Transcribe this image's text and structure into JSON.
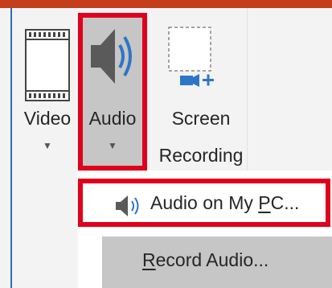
{
  "ribbon": {
    "video": {
      "label": "Video",
      "icon": "film-strip-icon"
    },
    "audio": {
      "label": "Audio",
      "icon": "speaker-icon",
      "highlight_color": "#e0001b"
    },
    "screen_recording": {
      "label_line1": "Screen",
      "label_line2": "Recording",
      "icon": "screen-recording-icon"
    }
  },
  "audio_menu": {
    "items": [
      {
        "label_prefix": "Audio on My ",
        "mnemonic": "P",
        "label_suffix": "C...",
        "icon": "speaker-icon",
        "highlighted": true
      },
      {
        "mnemonic": "R",
        "label_suffix": "ecord Audio...",
        "icon": null,
        "highlighted": false
      }
    ]
  },
  "colors": {
    "accent_top": "#c43e1c",
    "highlight_box": "#e0001b",
    "pressed_bg": "#c6c6c6"
  }
}
